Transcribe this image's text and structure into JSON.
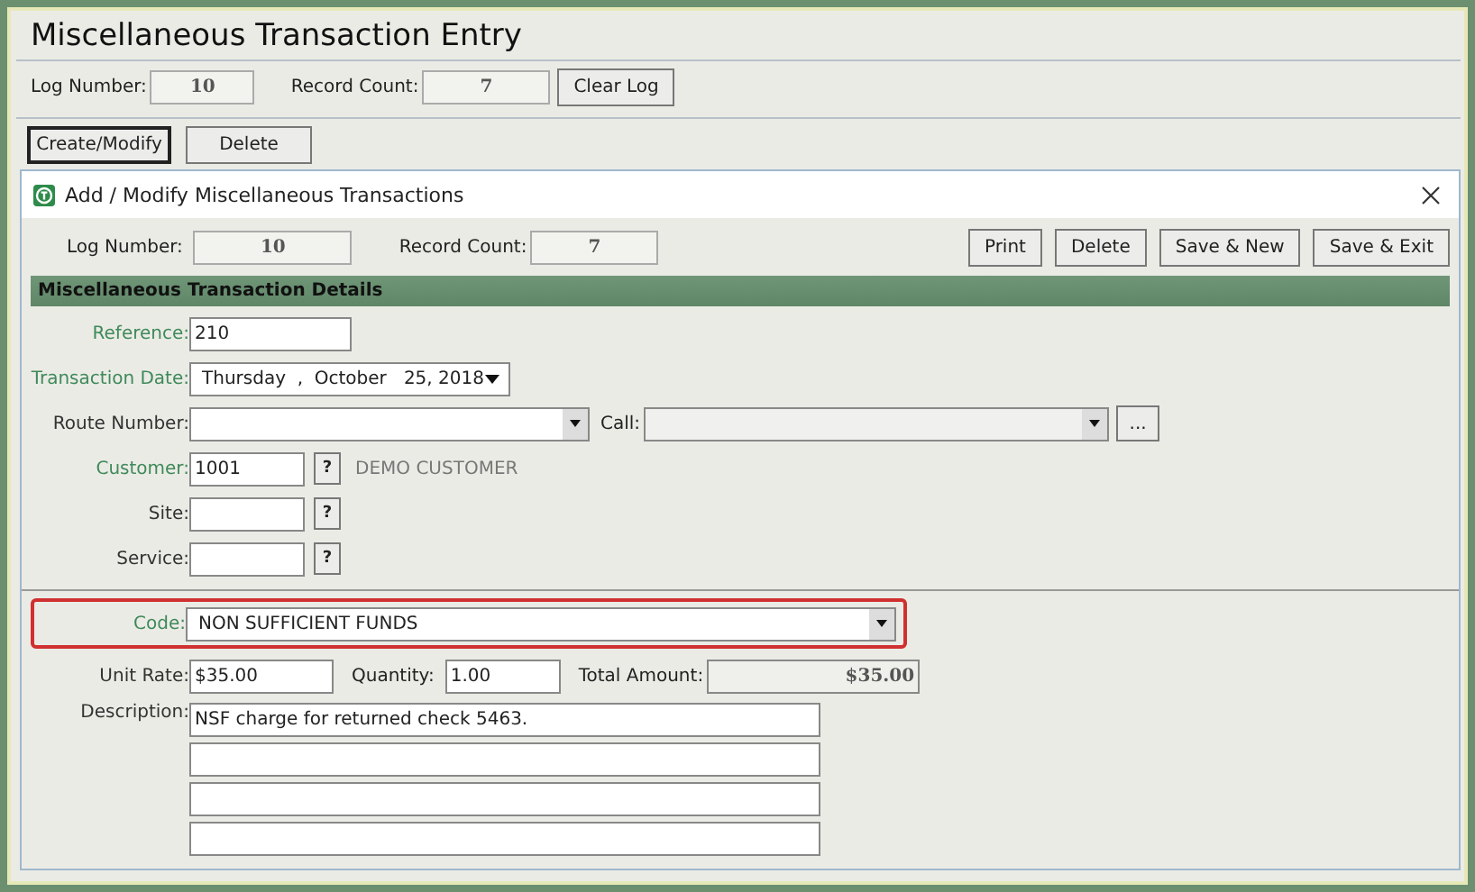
{
  "window": {
    "title": "Miscellaneous Transaction Entry"
  },
  "log": {
    "log_number_label": "Log Number:",
    "log_number": "10",
    "record_count_label": "Record Count:",
    "record_count": "7",
    "clear_button": "Clear Log"
  },
  "actions": [
    {
      "label": "Create/Modify",
      "focused": true
    },
    {
      "label": "Delete",
      "focused": false
    }
  ],
  "dialog": {
    "title": "Add / Modify Miscellaneous Transactions",
    "log_number_label": "Log Number:",
    "log_number": "10",
    "record_count_label": "Record Count:",
    "record_count": "7",
    "buttons": [
      "Print",
      "Delete",
      "Save & New",
      "Save & Exit"
    ],
    "section": "Miscellaneous Transaction Details",
    "reference": {
      "label": "Reference:",
      "value": "210",
      "required": true
    },
    "transaction_date": {
      "label": "Transaction Date:",
      "value": "Thursday  ,  October   25, 2018",
      "required": true
    },
    "route_number": {
      "label": "Route Number:",
      "required": false
    },
    "call": {
      "label": "Call:",
      "button": "..."
    },
    "customer": {
      "label": "Customer:",
      "value": "1001",
      "required": true,
      "lookup": "?",
      "name": "DEMO CUSTOMER"
    },
    "site": {
      "label": "Site:",
      "required": false,
      "lookup": "?"
    },
    "service": {
      "label": "Service:",
      "required": false,
      "lookup": "?"
    },
    "code": {
      "label": "Code:",
      "value": "NON SUFFICIENT FUNDS",
      "required": true,
      "highlighted": true
    },
    "unit_rate": {
      "label": "Unit Rate:",
      "value": "$35.00"
    },
    "quantity": {
      "label": "Quantity:",
      "value": "1.00"
    },
    "total_amount": {
      "label": "Total Amount:",
      "value": "$35.00"
    },
    "description": {
      "label": "Description:",
      "lines": [
        "NSF charge for returned check 5463."
      ]
    }
  }
}
